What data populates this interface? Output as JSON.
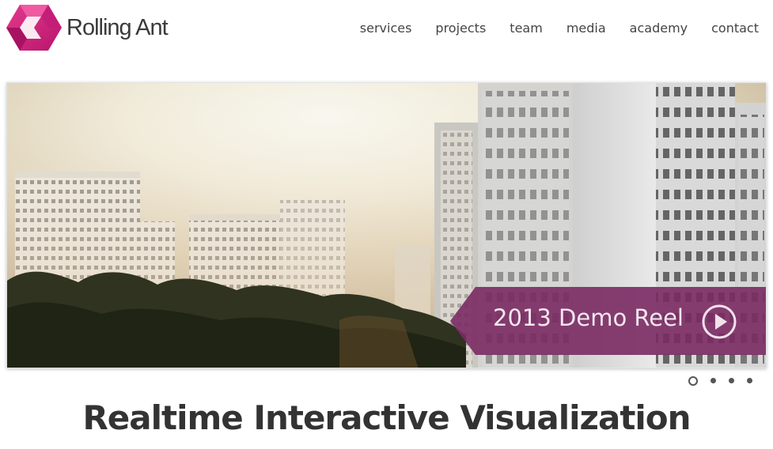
{
  "brand": {
    "name": "Rolling Ant",
    "accent": "#d6307f"
  },
  "nav": {
    "items": [
      {
        "label": "services"
      },
      {
        "label": "projects"
      },
      {
        "label": "team"
      },
      {
        "label": "media"
      },
      {
        "label": "academy"
      },
      {
        "label": "contact"
      }
    ]
  },
  "hero": {
    "banner_text": "2013 Demo Reel",
    "banner_color": "#7a2a63",
    "icon": "play-icon",
    "slides": {
      "count": 4,
      "active": 0
    }
  },
  "tagline": "Realtime Interactive Visualization"
}
